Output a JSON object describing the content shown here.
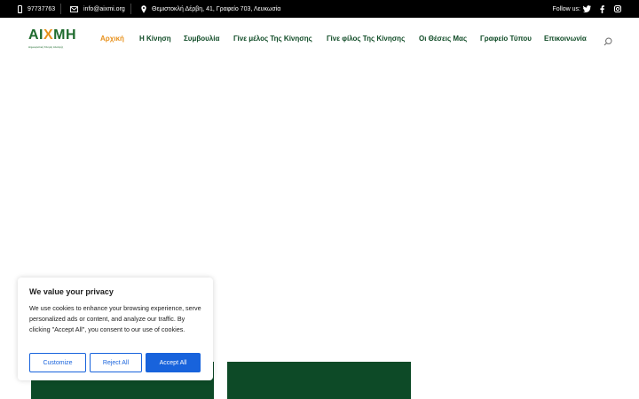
{
  "topbar": {
    "phone": "97737763",
    "email": "info@aixmi.org",
    "address": "Θεμιστοκλή Δέρβη, 41, Γραφείο 703, Λευκωσία",
    "follow_label": "Follow us:",
    "socials": [
      "twitter-icon",
      "facebook-icon",
      "instagram-icon"
    ]
  },
  "header": {
    "logo_text": "ΑΙΧΜΗ",
    "logo_subtitle": "Δημοκρατική Κίνηση Αλλαγής",
    "nav": [
      {
        "label": "Αρχική",
        "active": true
      },
      {
        "label": "Η Κίνηση",
        "active": false
      },
      {
        "label": "Συμβουλία",
        "active": false
      },
      {
        "label": "Γίνε μέλος Της Κίνησης",
        "active": false
      },
      {
        "label": "Γίνε φίλος Της Κίνησης",
        "active": false
      },
      {
        "label": "Οι Θέσεις Μας",
        "active": false
      },
      {
        "label": "Γραφείο Τύπου",
        "active": false
      },
      {
        "label": "Επικοινωνία",
        "active": false
      }
    ]
  },
  "cookie": {
    "title": "We value your privacy",
    "text": "We use cookies to enhance your browsing experience, serve personalized ads or content, and analyze our traffic. By clicking \"Accept All\", you consent to our use of cookies.",
    "customize_label": "Customize",
    "reject_label": "Reject All",
    "accept_label": "Accept All"
  },
  "colors": {
    "topbar_bg": "#000000",
    "nav_text": "#0e4a25",
    "nav_active": "#e8921e",
    "brand_green": "#0d4a27",
    "cookie_accent": "#1863dc"
  }
}
